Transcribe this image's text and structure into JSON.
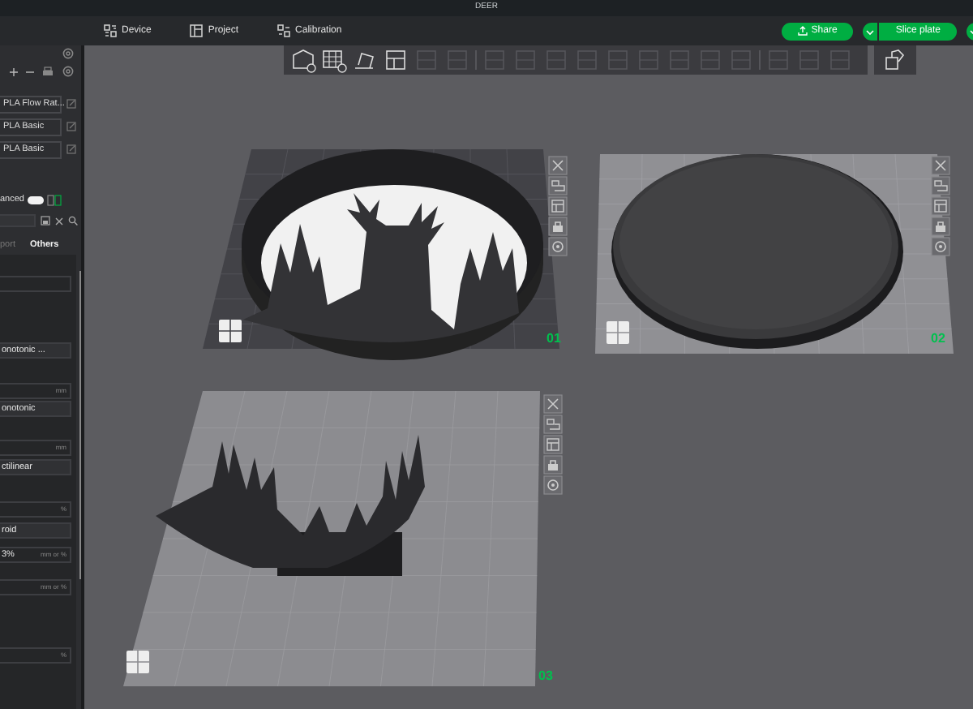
{
  "window": {
    "title": "DEER"
  },
  "menu": [
    {
      "kind": "device",
      "label": "Device",
      "selected": false
    },
    {
      "kind": "project",
      "label": "Project",
      "selected": false
    },
    {
      "kind": "calibration",
      "label": "Calibration",
      "selected": false
    }
  ],
  "actions": [
    {
      "kind": "share",
      "label": "Share"
    },
    {
      "kind": "split",
      "label": "Slice plate"
    },
    {
      "kind": "split-cut"
    }
  ],
  "sidebar": {
    "filaments": [
      {
        "name": "PLA Flow Rat..."
      },
      {
        "name": "PLA Basic"
      },
      {
        "name": "PLA Basic"
      }
    ],
    "advanced": {
      "label": "anced",
      "on": true
    },
    "tabs": [
      {
        "label": "port",
        "selected": false
      },
      {
        "label": "Others",
        "selected": true
      }
    ],
    "fields": [
      {
        "kind": "input"
      },
      {
        "kind": "select",
        "value": "onotonic ..."
      },
      {
        "kind": "input",
        "unit": "mm"
      },
      {
        "kind": "select",
        "value": "onotonic"
      },
      {
        "kind": "input",
        "unit": "mm"
      },
      {
        "kind": "select",
        "value": "ctilinear"
      },
      {
        "kind": "input",
        "unit": "%"
      },
      {
        "kind": "select",
        "value": "roid"
      },
      {
        "kind": "input",
        "value": "3%",
        "unit": "mm or %"
      },
      {
        "kind": "input",
        "unit": "mm or %"
      },
      {
        "kind": "input",
        "unit": "%"
      }
    ]
  },
  "plates": [
    {
      "kind": "lithophane",
      "number": "01"
    },
    {
      "kind": "disc",
      "number": "02"
    },
    {
      "kind": "antlers",
      "number": "03"
    }
  ]
}
